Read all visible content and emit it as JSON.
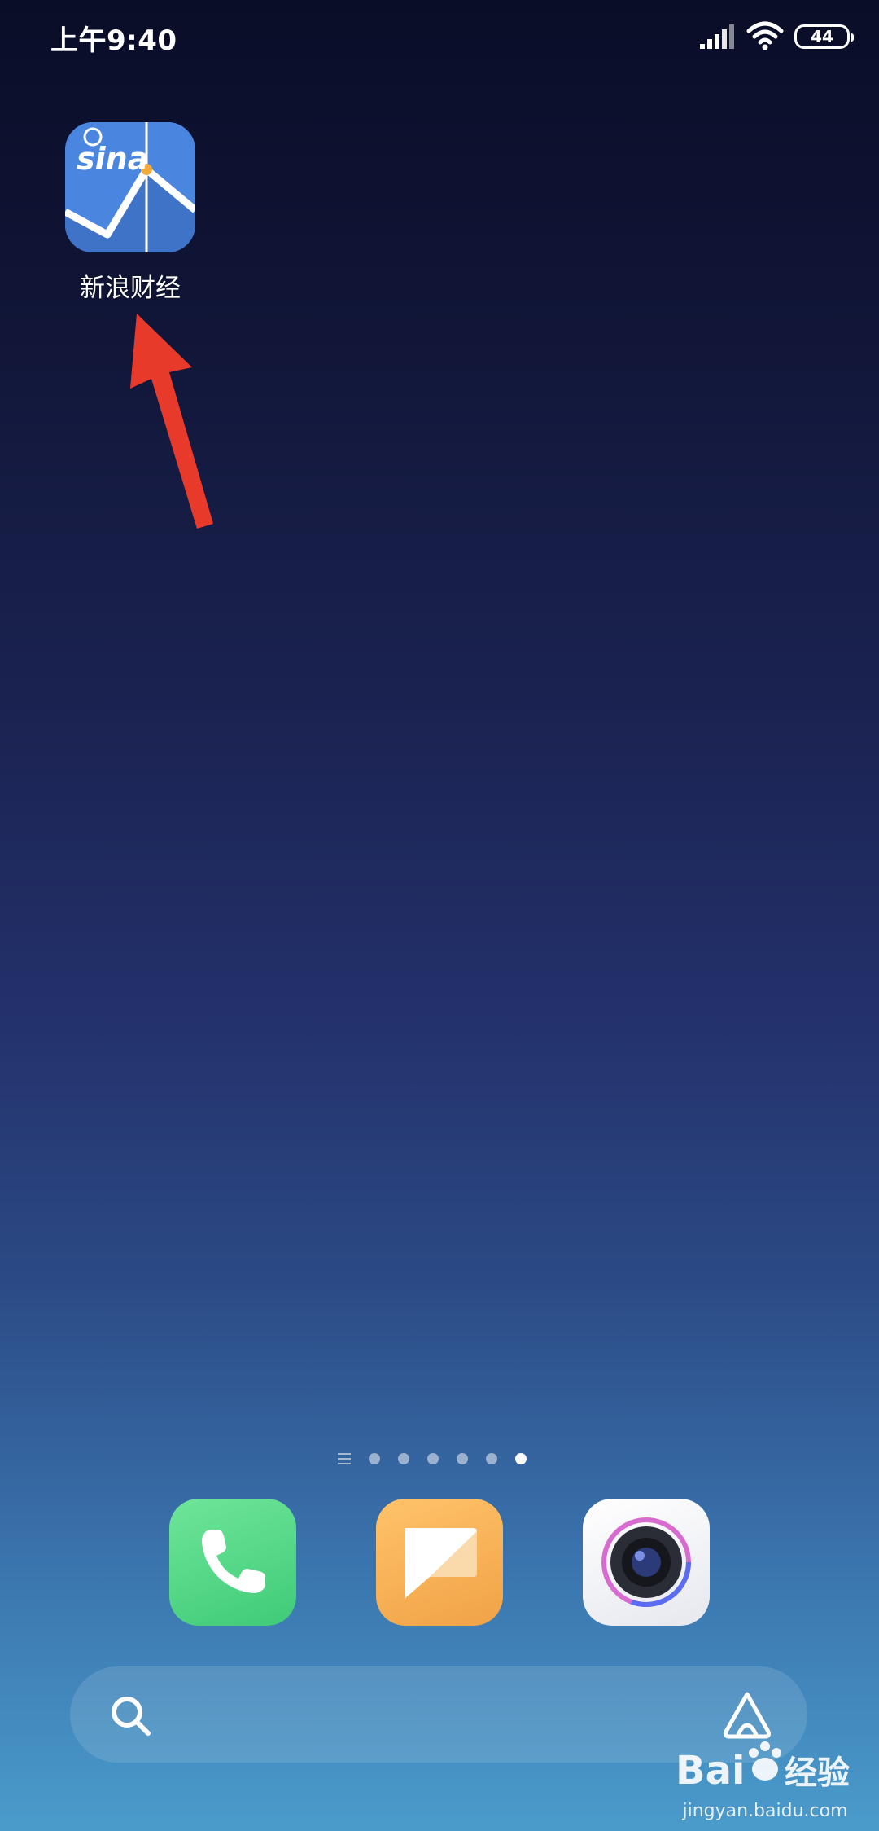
{
  "status_bar": {
    "time": "上午9:40",
    "battery_level": "44"
  },
  "home": {
    "apps": [
      {
        "label": "新浪财经",
        "icon": "sina-finance-icon"
      }
    ],
    "page_indicator": {
      "pages": 6,
      "active_page": 6
    }
  },
  "dock": {
    "apps": [
      "phone-icon",
      "messages-icon",
      "camera-icon"
    ]
  },
  "search_bar": {
    "icon": "search-icon",
    "assistant_icon": "assistant-icon"
  },
  "watermark": {
    "text": "jingyan.baidu.com"
  },
  "colors": {
    "annotation_arrow": "#e83a2b",
    "sina_blue": "#4a86e0",
    "phone_green": "#4fd987",
    "messages_orange": "#f5ad52"
  }
}
